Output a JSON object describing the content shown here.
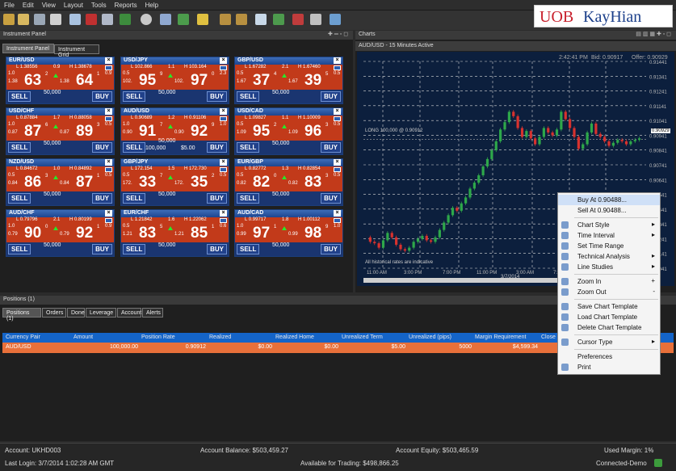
{
  "menu": [
    "File",
    "Edit",
    "View",
    "Layout",
    "Tools",
    "Reports",
    "Help"
  ],
  "logo": {
    "uob": "UOB",
    "kay": "KayHian"
  },
  "instrument_panel": {
    "title": "Instrument Panel",
    "tabs": [
      "Instrument Panel",
      "Instrument Grid"
    ]
  },
  "instruments": [
    {
      "pair": "EUR/USD",
      "low": "L 1.38556",
      "spread": "0.9",
      "high": "H 1.38678",
      "sell_pre": "1.38",
      "sell_big": "63",
      "sell_sup": "2",
      "buy_pre": "1.38",
      "buy_big": "64",
      "buy_sup": "1",
      "l_num": "1.0",
      "r_num": "0.9",
      "amount": "50,000"
    },
    {
      "pair": "USD/JPY",
      "low": "L 102.866",
      "spread": "1.1",
      "high": "H 103.164",
      "sell_pre": "102.",
      "sell_big": "95",
      "sell_sup": "9",
      "buy_pre": "102.",
      "buy_big": "97",
      "buy_sup": "0",
      "l_num": "0.5",
      "r_num": "2.3",
      "amount": "50,000"
    },
    {
      "pair": "GBP/USD",
      "low": "L 1.67282",
      "spread": "2.1",
      "high": "H 1.67460",
      "sell_pre": "1.67",
      "sell_big": "37",
      "sell_sup": "4",
      "buy_pre": "1.67",
      "buy_big": "39",
      "buy_sup": "5",
      "l_num": "0.5",
      "r_num": "0.5",
      "amount": "50,000"
    },
    {
      "pair": "USD/CHF",
      "low": "L 0.87884",
      "spread": "1.7",
      "high": "H 0.88058",
      "sell_pre": "0.87",
      "sell_big": "87",
      "sell_sup": "6",
      "buy_pre": "0.87",
      "buy_big": "89",
      "buy_sup": "3",
      "l_num": "1.0",
      "r_num": "0.5",
      "amount": "50,000"
    },
    {
      "pair": "AUD/USD",
      "low": "L 0.90689",
      "spread": "1.2",
      "high": "H 0.91106",
      "sell_pre": "0.90",
      "sell_big": "91",
      "sell_sup": "7",
      "buy_pre": "0.90",
      "buy_big": "92",
      "buy_sup": "9",
      "l_num": "1.0",
      "r_num": "1.0",
      "amount": "50,000",
      "pos_amount": "100,000",
      "pos_pl": "$5.00"
    },
    {
      "pair": "USD/CAD",
      "low": "L 1.09827",
      "spread": "1.1",
      "high": "H 1.10009",
      "sell_pre": "1.09",
      "sell_big": "95",
      "sell_sup": "2",
      "buy_pre": "1.09",
      "buy_big": "96",
      "buy_sup": "3",
      "l_num": "0.5",
      "r_num": "0.5",
      "amount": "50,000"
    },
    {
      "pair": "NZD/USD",
      "low": "L 0.84672",
      "spread": "1.0",
      "high": "H 0.84892",
      "sell_pre": "0.84",
      "sell_big": "86",
      "sell_sup": "3",
      "buy_pre": "0.84",
      "buy_big": "87",
      "buy_sup": "1",
      "l_num": "0.5",
      "r_num": "0.5",
      "amount": "50,000"
    },
    {
      "pair": "GBP/JPY",
      "low": "L 172.154",
      "spread": "1.5",
      "high": "H 172.730",
      "sell_pre": "172.",
      "sell_big": "33",
      "sell_sup": "7",
      "buy_pre": "172.",
      "buy_big": "35",
      "buy_sup": "2",
      "l_num": "0.5",
      "r_num": "0.5",
      "amount": "50,000"
    },
    {
      "pair": "EUR/GBP",
      "low": "L 0.82772",
      "spread": "1.3",
      "high": "H 0.82854",
      "sell_pre": "0.82",
      "sell_big": "82",
      "sell_sup": "0",
      "buy_pre": "0.82",
      "buy_big": "83",
      "buy_sup": "3",
      "l_num": "0.5",
      "r_num": "0.5",
      "amount": "50,000"
    },
    {
      "pair": "AUD/CHF",
      "low": "L 0.79796",
      "spread": "2.1",
      "high": "H 0.80199",
      "sell_pre": "0.79",
      "sell_big": "90",
      "sell_sup": "0",
      "buy_pre": "0.79",
      "buy_big": "92",
      "buy_sup": "1",
      "l_num": "1.0",
      "r_num": "0.9",
      "amount": "50,000"
    },
    {
      "pair": "EUR/CHF",
      "low": "L 1.21842",
      "spread": "1.6",
      "high": "H 1.22062",
      "sell_pre": "1.21",
      "sell_big": "83",
      "sell_sup": "5",
      "buy_pre": "1.21",
      "buy_big": "85",
      "buy_sup": "1",
      "l_num": "0.5",
      "r_num": "0.6",
      "amount": "50,000"
    },
    {
      "pair": "AUD/CAD",
      "low": "L 0.99717",
      "spread": "1.8",
      "high": "H 1.00112",
      "sell_pre": "0.99",
      "sell_big": "97",
      "sell_sup": "1",
      "buy_pre": "0.99",
      "buy_big": "98",
      "buy_sup": "9",
      "l_num": "1.0",
      "r_num": "1.0",
      "amount": "50,000"
    }
  ],
  "sell_label": "SELL",
  "buy_label": "BUY",
  "close_glyph": "×",
  "charts": {
    "title": "Charts",
    "subtitle": "AUD/USD - 15 Minutes Active",
    "time": "2:42:41 PM",
    "bid": "Bid: 0.90917",
    "offer": "Offer: 0.90929",
    "line_label": "LONG  100,000 @ 0.90912",
    "footnote": "All historical rates are indicative",
    "y_ticks": [
      "0.91441",
      "0.91341",
      "0.91241",
      "0.91141",
      "0.91041",
      "0.90941",
      "0.90841",
      "0.90741",
      "0.90641",
      "0.90541",
      "0.90441",
      "0.90341",
      "0.90241",
      "0.90141",
      "0.90041"
    ],
    "x_ticks": [
      "11:00 AM",
      "3:00 PM",
      "7:00 PM",
      "11:00 PM",
      "3:00 AM",
      "7:00 AM",
      "11:00 AM"
    ],
    "date_label": "3/7/2014",
    "current_price": "0.90929"
  },
  "positions": {
    "title": "Positions (1)",
    "tabs": [
      "Positions (1)",
      "Orders",
      "Done",
      "Leverage",
      "Account",
      "Alerts"
    ],
    "columns": [
      "Currency Pair",
      "Amount",
      "Position Rate",
      "Realized",
      "Realized Home",
      "Unrealized Term",
      "Unrealized (pips)",
      "Margin Requirement",
      "Close"
    ],
    "rows": [
      [
        "AUD/USD",
        "100,000.00",
        "0.90912",
        "$0.00",
        "$0.00",
        "$5.00",
        "5000",
        "$4,599.34",
        ""
      ]
    ]
  },
  "context_menu": {
    "items": [
      {
        "label": "Buy At 0.90488...",
        "icon": "none"
      },
      {
        "label": "Sell At 0.90488...",
        "icon": "none"
      },
      {
        "label": "Chart Style",
        "icon": "chart-style-icon",
        "arrow": "▸"
      },
      {
        "label": "Time Interval",
        "icon": "clock-icon",
        "arrow": "▸"
      },
      {
        "label": "Set Time Range",
        "icon": "time-range-icon"
      },
      {
        "label": "Technical Analysis",
        "icon": "technical-analysis-icon",
        "arrow": "▸"
      },
      {
        "label": "Line Studies",
        "icon": "line-studies-icon",
        "arrow": "▸"
      },
      {
        "label": "Zoom In",
        "icon": "zoom-in-icon",
        "shortcut": "+"
      },
      {
        "label": "Zoom Out",
        "icon": "zoom-out-icon",
        "shortcut": "-"
      },
      {
        "label": "Save Chart Template",
        "icon": "save-icon"
      },
      {
        "label": "Load Chart Template",
        "icon": "load-icon"
      },
      {
        "label": "Delete Chart Template",
        "icon": "delete-icon"
      },
      {
        "label": "Cursor Type",
        "icon": "cursor-icon",
        "arrow": "▸"
      },
      {
        "label": "Preferences",
        "icon": "none"
      },
      {
        "label": "Print",
        "icon": "print-icon"
      }
    ]
  },
  "status": {
    "account": "Account:  UKHD003",
    "balance": "Account Balance:  $503,459.27",
    "equity": "Account Equity:  $503,465.59",
    "margin": "Used Margin:  1%",
    "last_login": "Last Login:  3/7/2014 1:02:28 AM GMT",
    "available": "Available for Trading:  $498,866.25",
    "connection": "Connected-Demo"
  }
}
